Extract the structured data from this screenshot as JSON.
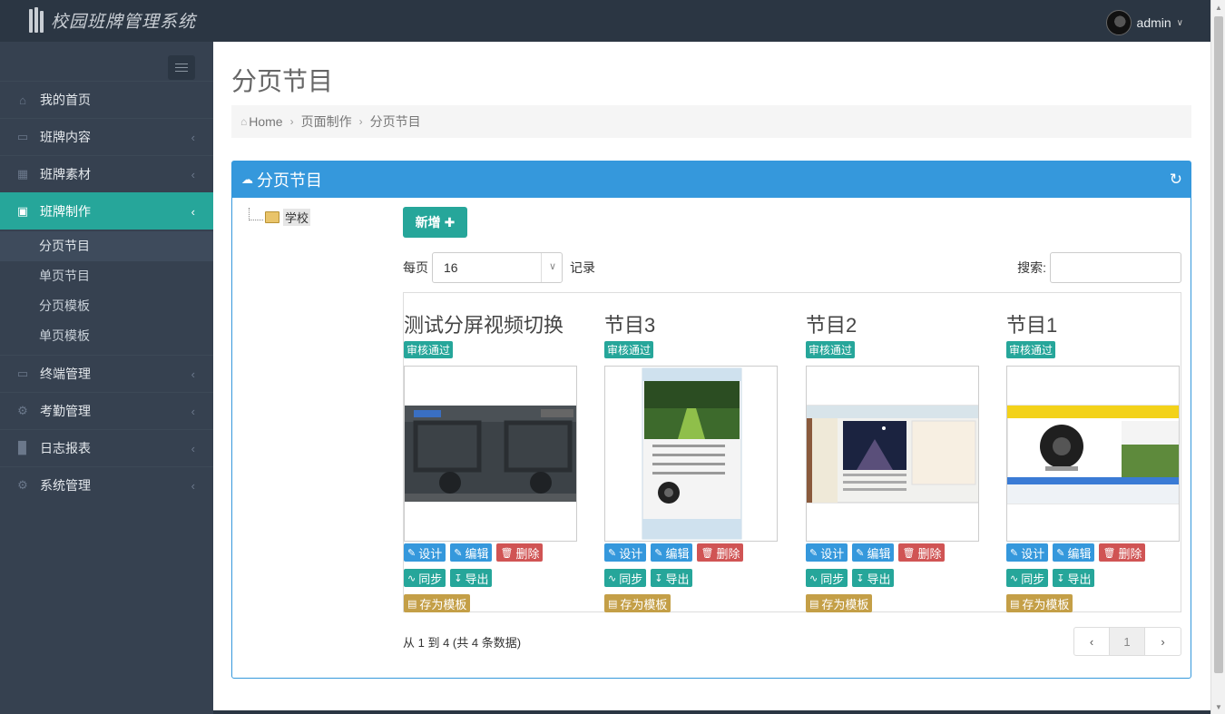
{
  "app": {
    "title": "校园班牌管理系统"
  },
  "user": {
    "name": "admin"
  },
  "sidebar": {
    "items": [
      {
        "label": "我的首页",
        "icon": "home-icon"
      },
      {
        "label": "班牌内容",
        "icon": "monitor-icon"
      },
      {
        "label": "班牌素材",
        "icon": "qrcode-icon"
      },
      {
        "label": "班牌制作",
        "icon": "html5-icon"
      },
      {
        "label": "终端管理",
        "icon": "monitor-icon"
      },
      {
        "label": "考勤管理",
        "icon": "cogs-icon"
      },
      {
        "label": "日志报表",
        "icon": "bar-chart-icon"
      },
      {
        "label": "系统管理",
        "icon": "cogs-icon"
      }
    ],
    "submenu": [
      "分页节目",
      "单页节目",
      "分页模板",
      "单页模板"
    ]
  },
  "page": {
    "title": "分页节目",
    "breadcrumb": [
      "Home",
      "页面制作",
      "分页节目"
    ]
  },
  "portlet": {
    "title": "分页节目"
  },
  "tree": {
    "root": "学校"
  },
  "toolbar": {
    "new_label": "新增",
    "per_page_label": "每页",
    "per_page_value": "16",
    "records_label": "记录",
    "search_label": "搜索:"
  },
  "cards": [
    {
      "title": "测试分屏视频切换",
      "status": "审核通过"
    },
    {
      "title": "节目3",
      "status": "审核通过"
    },
    {
      "title": "节目2",
      "status": "审核通过"
    },
    {
      "title": "节目1",
      "status": "审核通过"
    }
  ],
  "actions": {
    "design": "设计",
    "edit": "编辑",
    "delete": "删除",
    "sync": "同步",
    "export": "导出",
    "save_template": "存为模板"
  },
  "pagination": {
    "info": "从 1 到 4 (共 4 条数据)",
    "current": "1",
    "prev": "‹",
    "next": "›"
  },
  "colors": {
    "accent": "#26a69a",
    "primary": "#3598dc",
    "danger": "#d05454",
    "warning": "#c49f47",
    "sidebar": "#364150"
  }
}
